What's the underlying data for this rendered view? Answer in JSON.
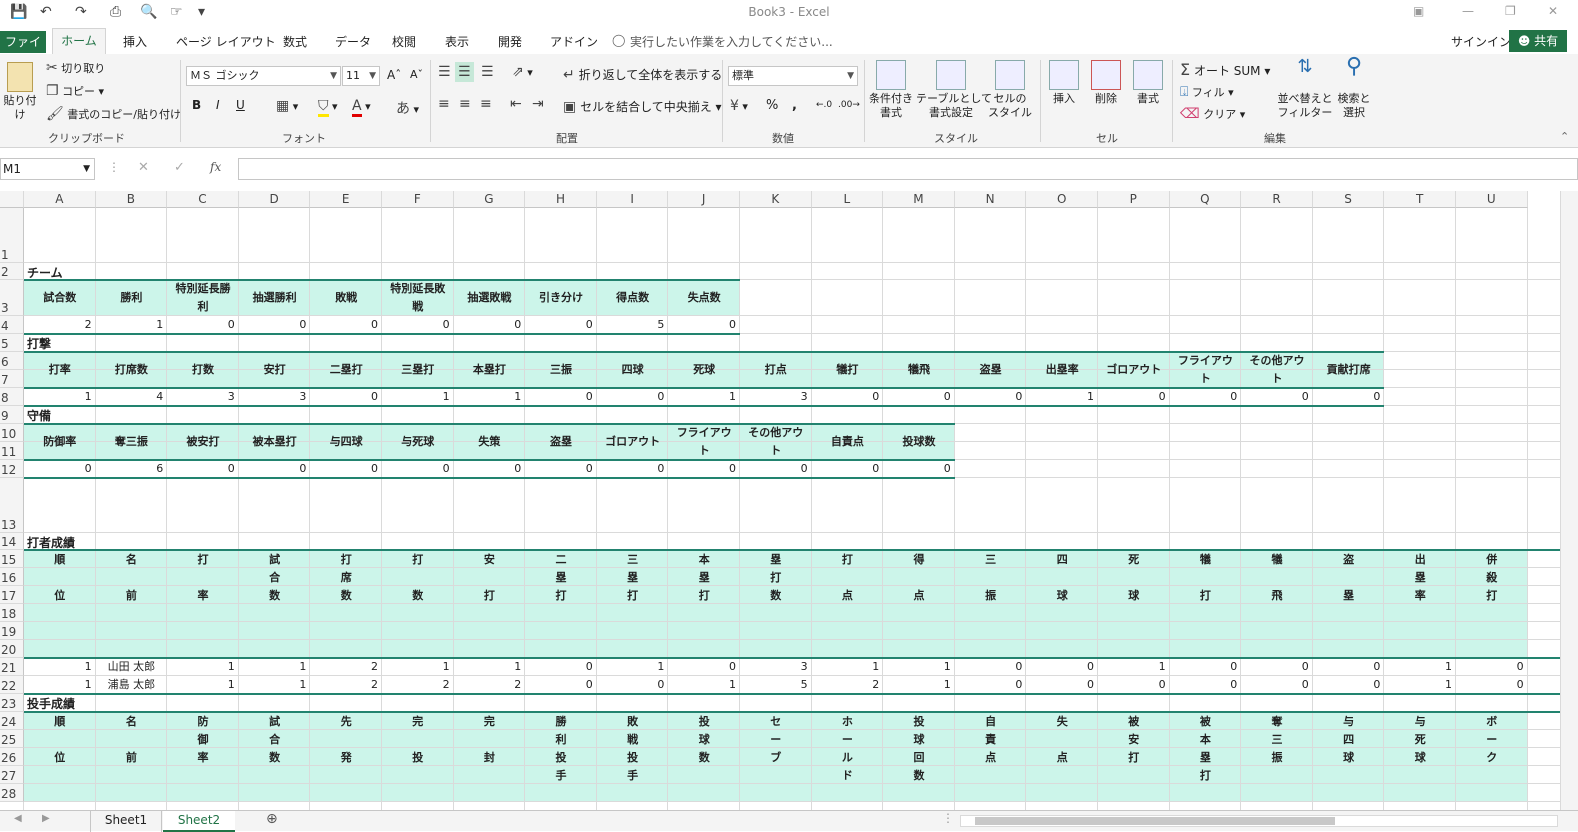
{
  "window": {
    "title": "Book3 - Excel"
  },
  "tabs": {
    "file": "ファイル",
    "home": "ホーム",
    "insert": "挿入",
    "page_layout": "ページ レイアウト",
    "formulas": "数式",
    "data": "データ",
    "review": "校閲",
    "view": "表示",
    "developer": "開発",
    "addins": "アドイン",
    "search_hint": "実行したい作業を入力してください...",
    "signin": "サインイン",
    "share": "共有"
  },
  "ribbon": {
    "clipboard": {
      "label": "クリップボード",
      "paste": "貼り付け",
      "cut": "切り取り",
      "copy": "コピー",
      "format_painter": "書式のコピー/貼り付け"
    },
    "font": {
      "label": "フォント",
      "name": "ＭＳ ゴシック",
      "size": "11",
      "bold": "B",
      "italic": "I",
      "underline": "U"
    },
    "alignment": {
      "label": "配置",
      "wrap": "折り返して全体を表示する",
      "merge": "セルを結合して中央揃え"
    },
    "number": {
      "label": "数値",
      "format": "標準",
      "percent": "%",
      "comma": ","
    },
    "styles": {
      "label": "スタイル",
      "conditional": "条件付き\n書式",
      "as_table": "テーブルとして\n書式設定",
      "cell_styles": "セルの\nスタイル"
    },
    "cells": {
      "label": "セル",
      "insert": "挿入",
      "delete": "削除",
      "format": "書式"
    },
    "editing": {
      "label": "編集",
      "autosum": "オート SUM",
      "fill": "フィル",
      "clear": "クリア",
      "sort": "並べ替えと\nフィルター",
      "find": "検索と\n選択"
    }
  },
  "formula_bar": {
    "name_box": "M1",
    "fx": "fx",
    "content": ""
  },
  "columns": [
    "A",
    "B",
    "C",
    "D",
    "E",
    "F",
    "G",
    "H",
    "I",
    "J",
    "K",
    "L",
    "M",
    "N",
    "O",
    "P",
    "Q",
    "R",
    "S",
    "T",
    "U"
  ],
  "rows": [
    "1",
    "2",
    "3",
    "4",
    "5",
    "6",
    "7",
    "8",
    "9",
    "10",
    "11",
    "12",
    "13",
    "14",
    "15",
    "16",
    "17",
    "18",
    "19",
    "20",
    "21",
    "22",
    "23",
    "24",
    "25",
    "26",
    "27",
    "28"
  ],
  "sheet": {
    "team": {
      "title": "チーム",
      "headers": [
        "試合数",
        "勝利",
        "特別延長勝利",
        "抽選勝利",
        "敗戦",
        "特別延長敗戦",
        "抽選敗戦",
        "引き分け",
        "得点数",
        "失点数"
      ],
      "values": [
        2,
        1,
        0,
        0,
        0,
        0,
        0,
        0,
        5,
        0
      ]
    },
    "batting": {
      "title": "打撃",
      "headers": [
        "打率",
        "打席数",
        "打数",
        "安打",
        "二塁打",
        "三塁打",
        "本塁打",
        "三振",
        "四球",
        "死球",
        "打点",
        "犠打",
        "犠飛",
        "盗塁",
        "出塁率",
        "ゴロアウト",
        "フライアウト",
        "その他アウト",
        "貢献打席"
      ],
      "values": [
        1,
        4,
        3,
        3,
        0,
        1,
        1,
        0,
        0,
        1,
        3,
        0,
        0,
        0,
        1,
        0,
        0,
        0,
        0
      ]
    },
    "defense": {
      "title": "守備",
      "headers": [
        "防御率",
        "奪三振",
        "被安打",
        "被本塁打",
        "与四球",
        "与死球",
        "失策",
        "盗塁",
        "ゴロアウト",
        "フライアウト",
        "その他アウト",
        "自責点",
        "投球数"
      ],
      "values": [
        0,
        6,
        0,
        0,
        0,
        0,
        0,
        0,
        0,
        0,
        0,
        0,
        0
      ]
    },
    "batter_stats": {
      "title": "打者成績",
      "headers": [
        "順位",
        "名前",
        "打率",
        "試合数",
        "打席数",
        "打数",
        "安打",
        "二塁打",
        "三塁打",
        "本塁打",
        "塁打数",
        "打点",
        "得点",
        "三振",
        "四球",
        "死球",
        "犠打",
        "犠飛",
        "盗塁",
        "出塁率",
        "併殺打"
      ],
      "rows": [
        {
          "rank": 1,
          "name": "山田 太郎",
          "values": [
            1,
            1,
            2,
            1,
            1,
            0,
            1,
            0,
            3,
            1,
            1,
            0,
            0,
            1,
            0,
            0,
            0,
            1,
            0
          ]
        },
        {
          "rank": 1,
          "name": "浦島 太郎",
          "values": [
            1,
            1,
            2,
            2,
            2,
            0,
            0,
            1,
            5,
            2,
            1,
            0,
            0,
            0,
            0,
            0,
            0,
            1,
            0
          ]
        }
      ]
    },
    "pitcher_stats": {
      "title": "投手成績",
      "headers": [
        "順位",
        "名前",
        "防御率",
        "試合数",
        "先発",
        "完投",
        "完封",
        "勝利投手",
        "敗戦投手",
        "投球数",
        "セーブ",
        "ホールド",
        "投球回数",
        "自責点",
        "失点",
        "被安打",
        "被本塁打",
        "奪三振",
        "与四球",
        "与死球",
        "ボーク"
      ]
    }
  },
  "sheet_tabs": [
    "Sheet1",
    "Sheet2"
  ],
  "colors": {
    "accent": "#217346",
    "band": "#ccf5ea",
    "band_line": "#22836f"
  }
}
